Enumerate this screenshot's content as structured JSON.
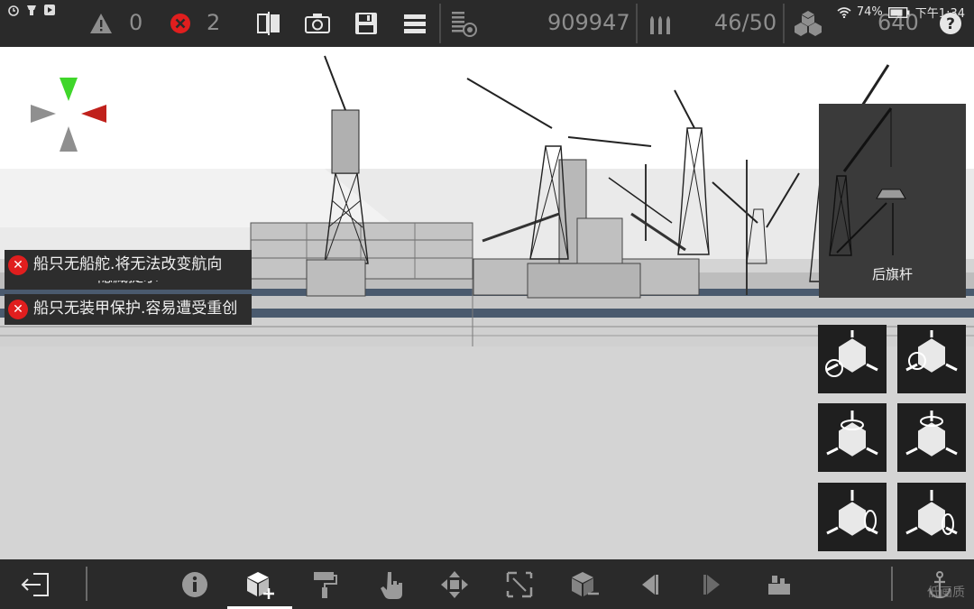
{
  "status_bar": {
    "battery": "74%",
    "time": "下午1:34"
  },
  "toolbar": {
    "warning_count": "0",
    "error_count": "2",
    "weight": "909947",
    "ammo": "46/50",
    "blocks": "640"
  },
  "hints": {
    "hide_label": "隐藏提示",
    "items": [
      {
        "text": "船只无船舵.将无法改变航向"
      },
      {
        "text": "船只无装甲保护.容易遭受重创"
      }
    ]
  },
  "preview": {
    "label": "后旗杆"
  },
  "watermark": "低画质",
  "colors": {
    "bar_bg": "#2a2a2a",
    "error_red": "#e01e1e",
    "axis_green": "#3fd62a",
    "axis_red": "#c0211c",
    "axis_gray": "#8f8f8f"
  }
}
